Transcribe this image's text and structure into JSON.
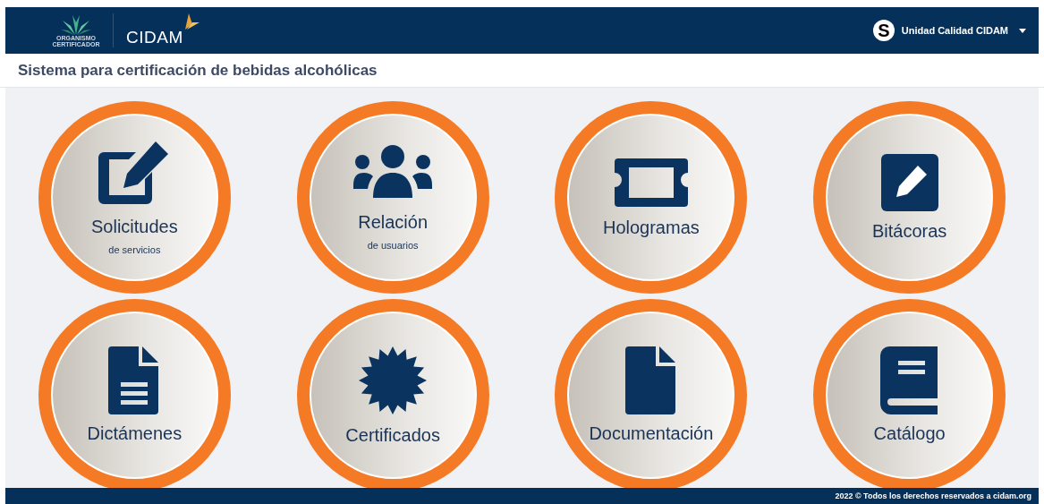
{
  "header": {
    "logo_caption": "ORGANISMO CERTIFICADOR",
    "brand": "CIDAM",
    "user": {
      "avatar_letter": "S",
      "name": "Unidad Calidad CIDAM"
    }
  },
  "page_title": "Sistema para certificación de bebidas alcohólicas",
  "modules": [
    {
      "title": "Solicitudes",
      "subtitle": "de servicios",
      "kind": "edit"
    },
    {
      "title": "Relación",
      "subtitle": "de usuarios",
      "kind": "users"
    },
    {
      "title": "Hologramas",
      "kind": "ticket"
    },
    {
      "title": "Bitácoras",
      "kind": "pencil"
    },
    {
      "title": "Dictámenes",
      "kind": "doc"
    },
    {
      "title": "Certificados",
      "kind": "seal"
    },
    {
      "title": "Documentación",
      "kind": "file"
    },
    {
      "title": "Catálogo",
      "kind": "book"
    }
  ],
  "footer": "2022 © Todos los derechos reservados a cidam.org"
}
